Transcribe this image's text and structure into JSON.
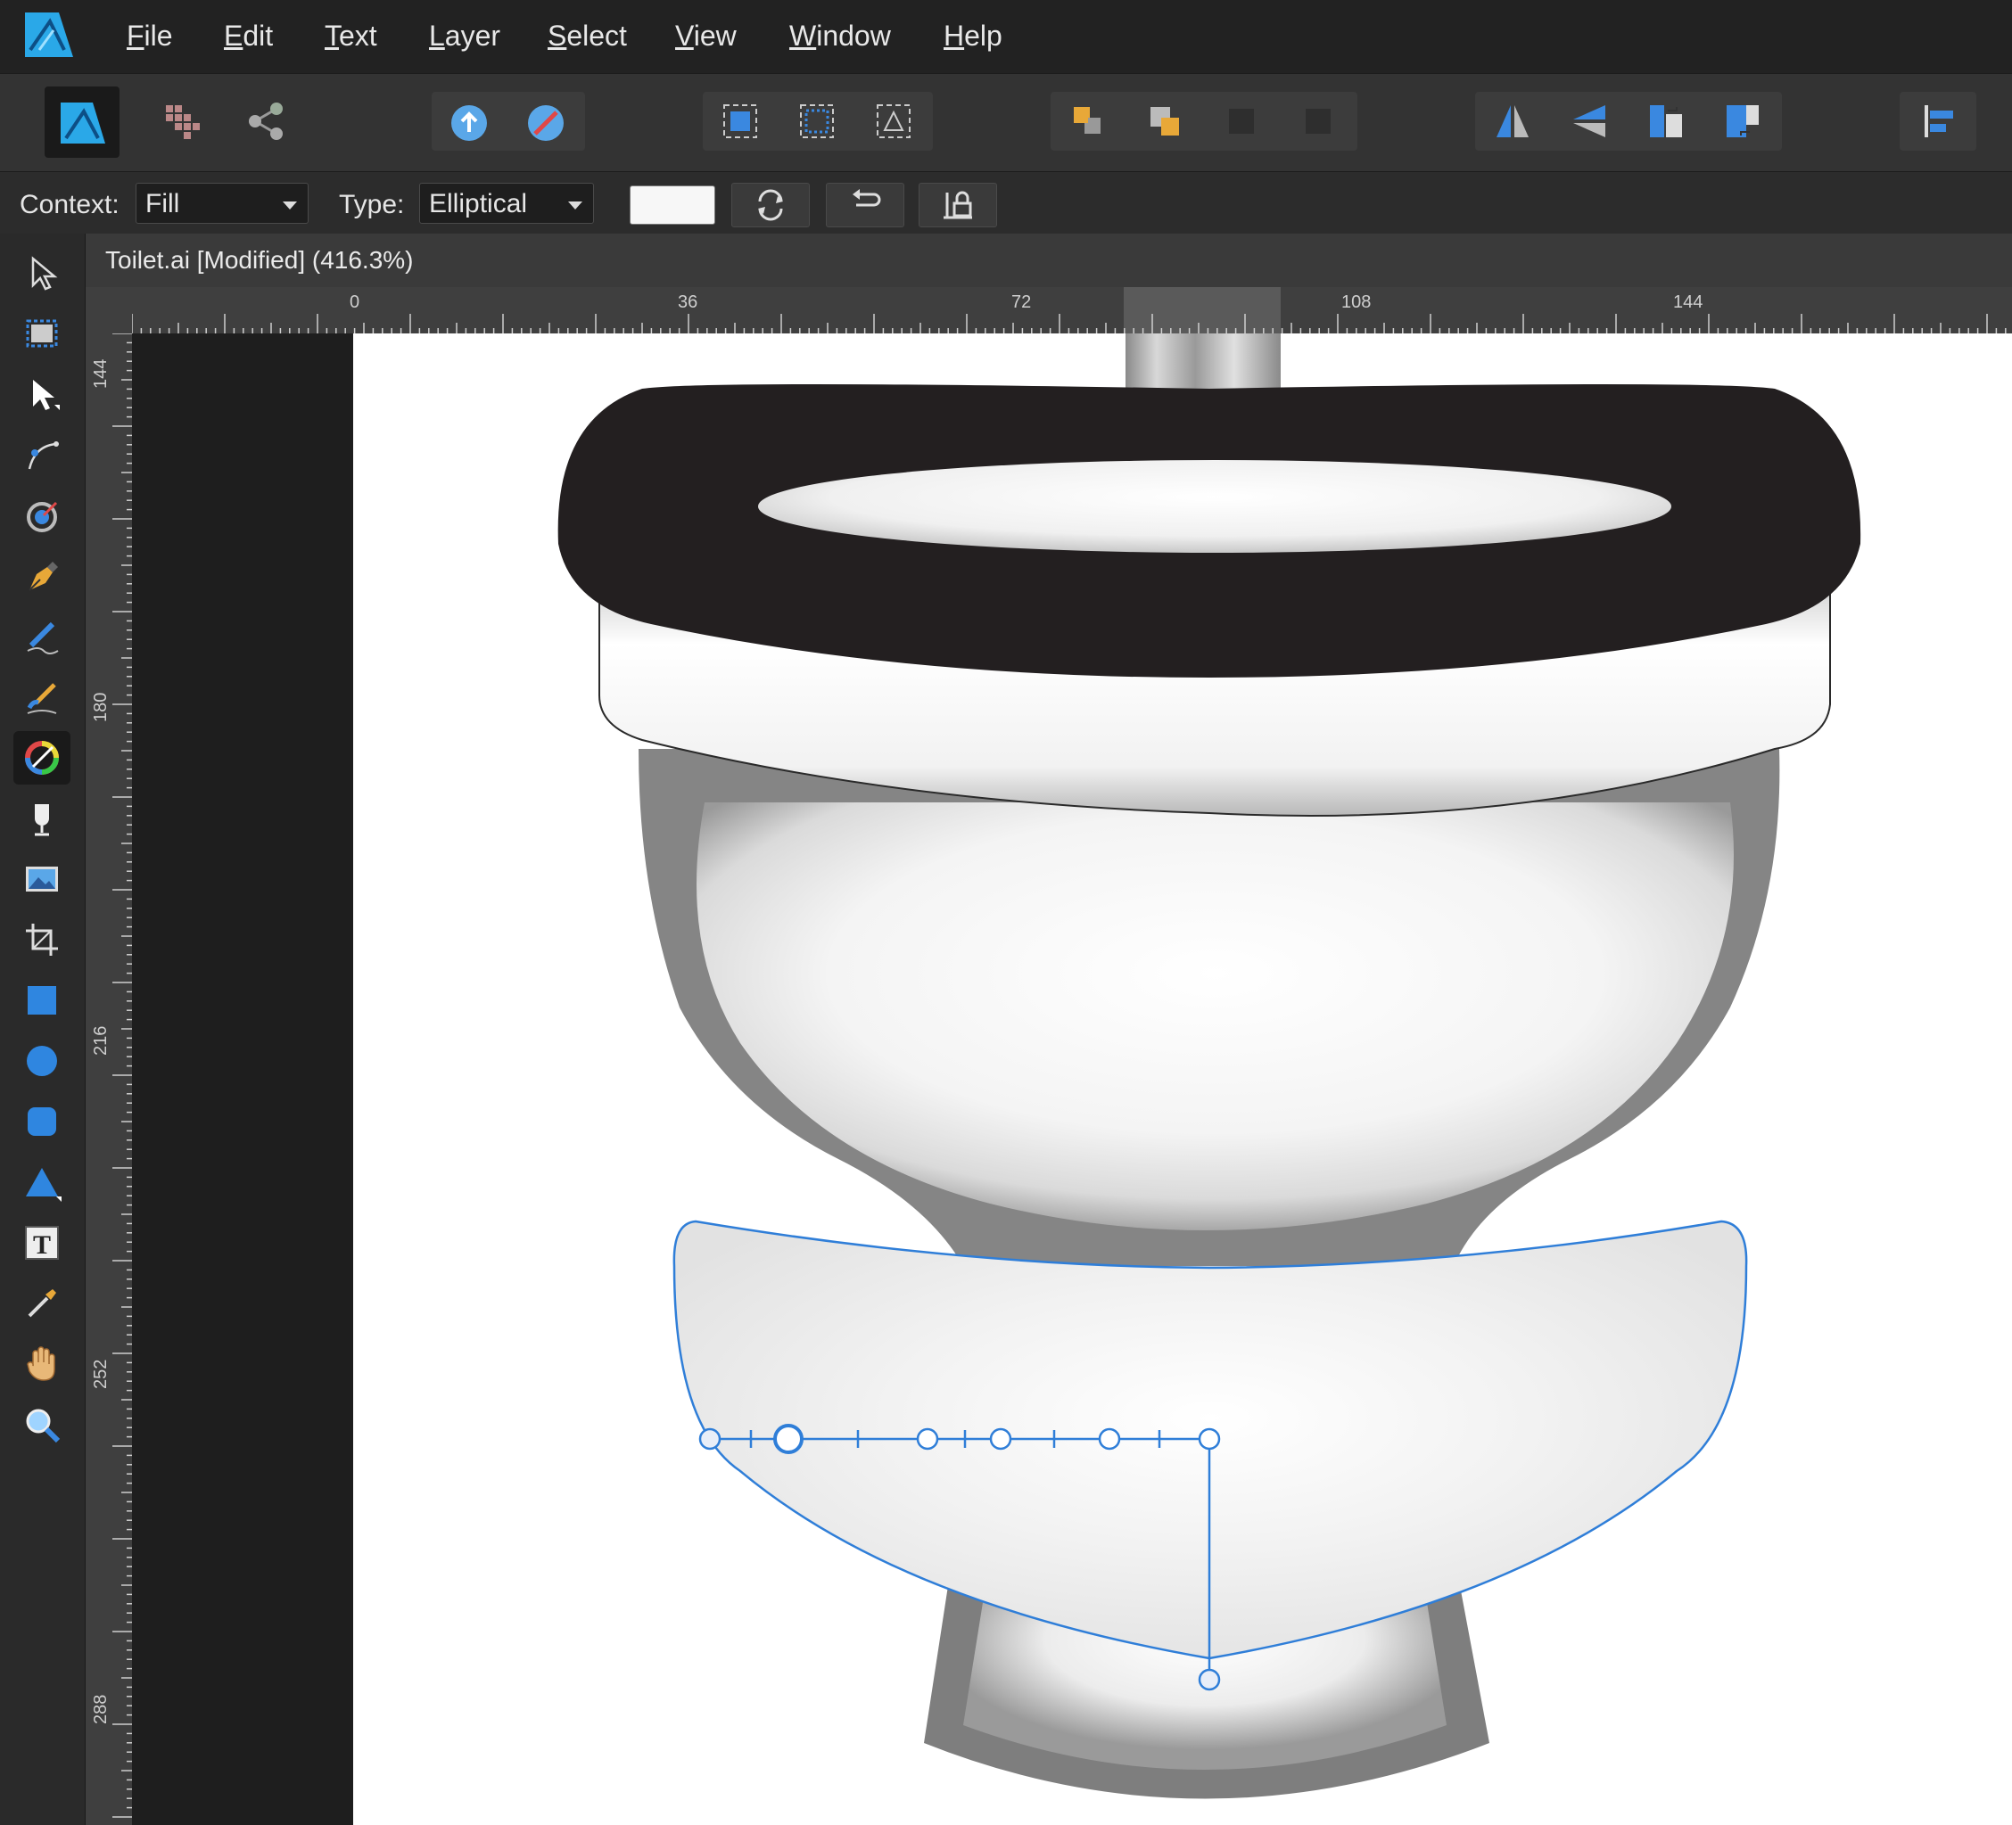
{
  "menu": {
    "file": "File",
    "edit": "Edit",
    "text": "Text",
    "layer": "Layer",
    "select": "Select",
    "view": "View",
    "window": "Window",
    "help": "Help"
  },
  "context_bar": {
    "context_label": "Context:",
    "context_value": "Fill",
    "type_label": "Type:",
    "type_value": "Elliptical"
  },
  "document": {
    "tab_title": "Toilet.ai [Modified] (416.3%)"
  },
  "ruler": {
    "unit": "pt",
    "h_labels": [
      "0",
      "36",
      "72",
      "108",
      "144"
    ],
    "v_labels": [
      "144",
      "180",
      "216",
      "252",
      "288"
    ]
  },
  "colors": {
    "accent": "#2f7ed8",
    "seat": "#231f20"
  },
  "icons": {
    "tools": [
      "move-icon",
      "artboard-icon",
      "node-icon",
      "corner-icon",
      "point-transform-icon",
      "pen-icon",
      "pencil-icon",
      "vector-brush-icon",
      "fill-icon",
      "transparency-icon",
      "place-image-icon",
      "crop-icon",
      "rectangle-icon",
      "ellipse-icon",
      "rounded-rectangle-icon",
      "triangle-icon",
      "artistic-text-icon",
      "color-picker-icon",
      "hand-icon",
      "zoom-icon"
    ]
  }
}
